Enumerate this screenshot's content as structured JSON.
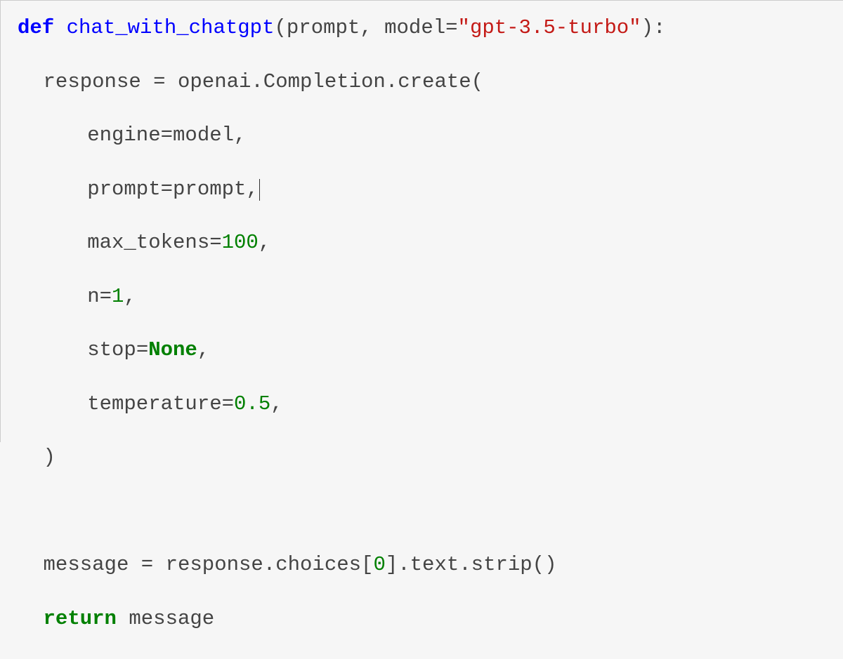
{
  "c": {
    "def": "def",
    "fn": "chat_with_chatgpt",
    "lp": "(",
    "p1": "prompt",
    "c1": ", ",
    "p2": "model",
    "eq": "=",
    "s1": "\"gpt-3.5-turbo\"",
    "rp": ")",
    "col": ":",
    "l2a": "response ",
    "assign": "= ",
    "l2b": "openai.Completion.create(",
    "l3a": "engine",
    "l3b": "model",
    "comma": ",",
    "l4a": "prompt",
    "l4b": "prompt",
    "l5a": "max_tokens",
    "l5b": "100",
    "l6a": "n",
    "l6b": "1",
    "l7a": "stop",
    "l7b": "None",
    "l8a": "temperature",
    "l8b": "0.5",
    "l9": ")",
    "l11a": "message ",
    "l11b": "response.choices[",
    "l11c": "0",
    "l11d": "].text.strip()",
    "ret": "return",
    "retv": " message"
  }
}
